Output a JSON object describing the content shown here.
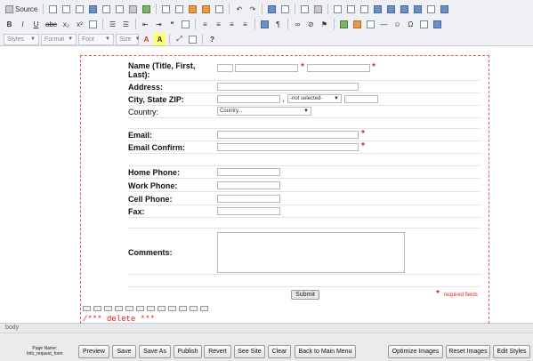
{
  "toolbar": {
    "source_label": "Source",
    "styles_combo": "Styles",
    "format_combo": "Format",
    "font_combo": "Font",
    "size_combo": "Size",
    "help_label": "?"
  },
  "form": {
    "name_label": "Name (Title, First, Last):",
    "address_label": "Address:",
    "city_label": "City, State ZIP:",
    "city_comma": ",",
    "state_select": "-not selected-",
    "country_label": "Country:",
    "country_select": "Country...",
    "email_label": "Email:",
    "email_confirm_label": "Email Confirm:",
    "home_phone_label": "Home Phone:",
    "work_phone_label": "Work Phone:",
    "cell_phone_label": "Cell Phone:",
    "fax_label": "Fax:",
    "comments_label": "Comments:",
    "submit_label": "Submit",
    "required_star": "*",
    "required_note": "required fields"
  },
  "editor": {
    "delete_text": "/*** delete ***"
  },
  "status_bar": {
    "path": "body"
  },
  "bottom": {
    "page_name_label": "Page Name:",
    "page_name_value": "Info_request_form",
    "buttons": [
      "Preview",
      "Save",
      "Save As",
      "Publish",
      "Revert",
      "See Site",
      "Clear",
      "Back to Main Menu",
      "Optimize Images",
      "Reset Images",
      "Edit Styles"
    ]
  }
}
